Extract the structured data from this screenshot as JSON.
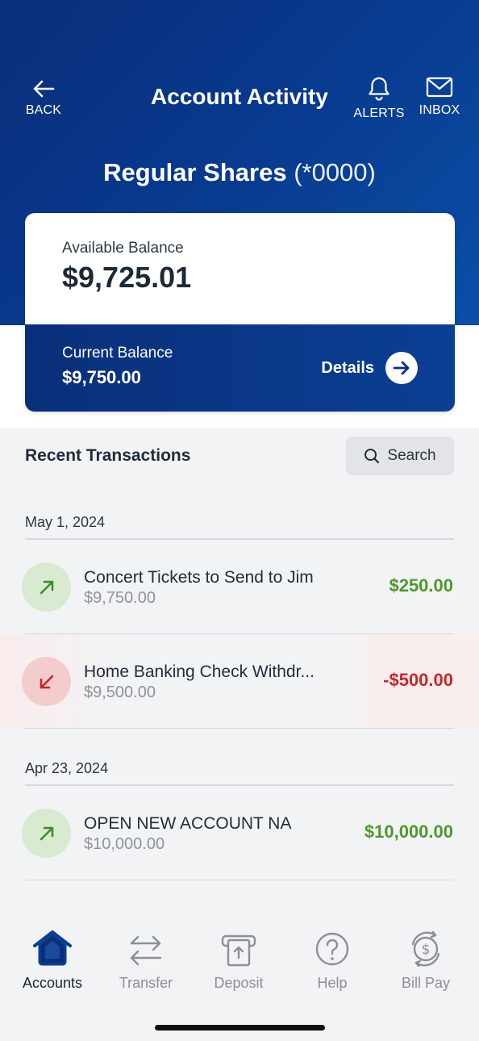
{
  "header": {
    "back_label": "BACK",
    "title": "Account Activity",
    "alerts_label": "ALERTS",
    "inbox_label": "INBOX"
  },
  "account": {
    "name": "Regular Shares",
    "mask": "(*0000)",
    "available_label": "Available Balance",
    "available_value": "$9,725.01",
    "current_label": "Current Balance",
    "current_value": "$9,750.00",
    "details_label": "Details"
  },
  "transactions": {
    "title": "Recent Transactions",
    "search_label": "Search",
    "groups": [
      {
        "date": "May 1, 2024",
        "items": [
          {
            "name": "Concert Tickets to Send to Jim",
            "balance": "$9,750.00",
            "amount": "$250.00",
            "direction": "credit"
          },
          {
            "name": "Home Banking Check Withdr...",
            "balance": "$9,500.00",
            "amount": "-$500.00",
            "direction": "debit"
          }
        ]
      },
      {
        "date": "Apr 23, 2024",
        "items": [
          {
            "name": "OPEN NEW ACCOUNT NA",
            "balance": "$10,000.00",
            "amount": "$10,000.00",
            "direction": "credit"
          }
        ]
      }
    ]
  },
  "tabs": [
    {
      "label": "Accounts",
      "icon": "home-icon",
      "active": true
    },
    {
      "label": "Transfer",
      "icon": "transfer-icon",
      "active": false
    },
    {
      "label": "Deposit",
      "icon": "deposit-icon",
      "active": false
    },
    {
      "label": "Help",
      "icon": "help-icon",
      "active": false
    },
    {
      "label": "Bill Pay",
      "icon": "bill-pay-icon",
      "active": false
    }
  ],
  "colors": {
    "brand_navy": "#0a2f7a",
    "positive": "#4c9a2a",
    "negative": "#c8262a"
  }
}
